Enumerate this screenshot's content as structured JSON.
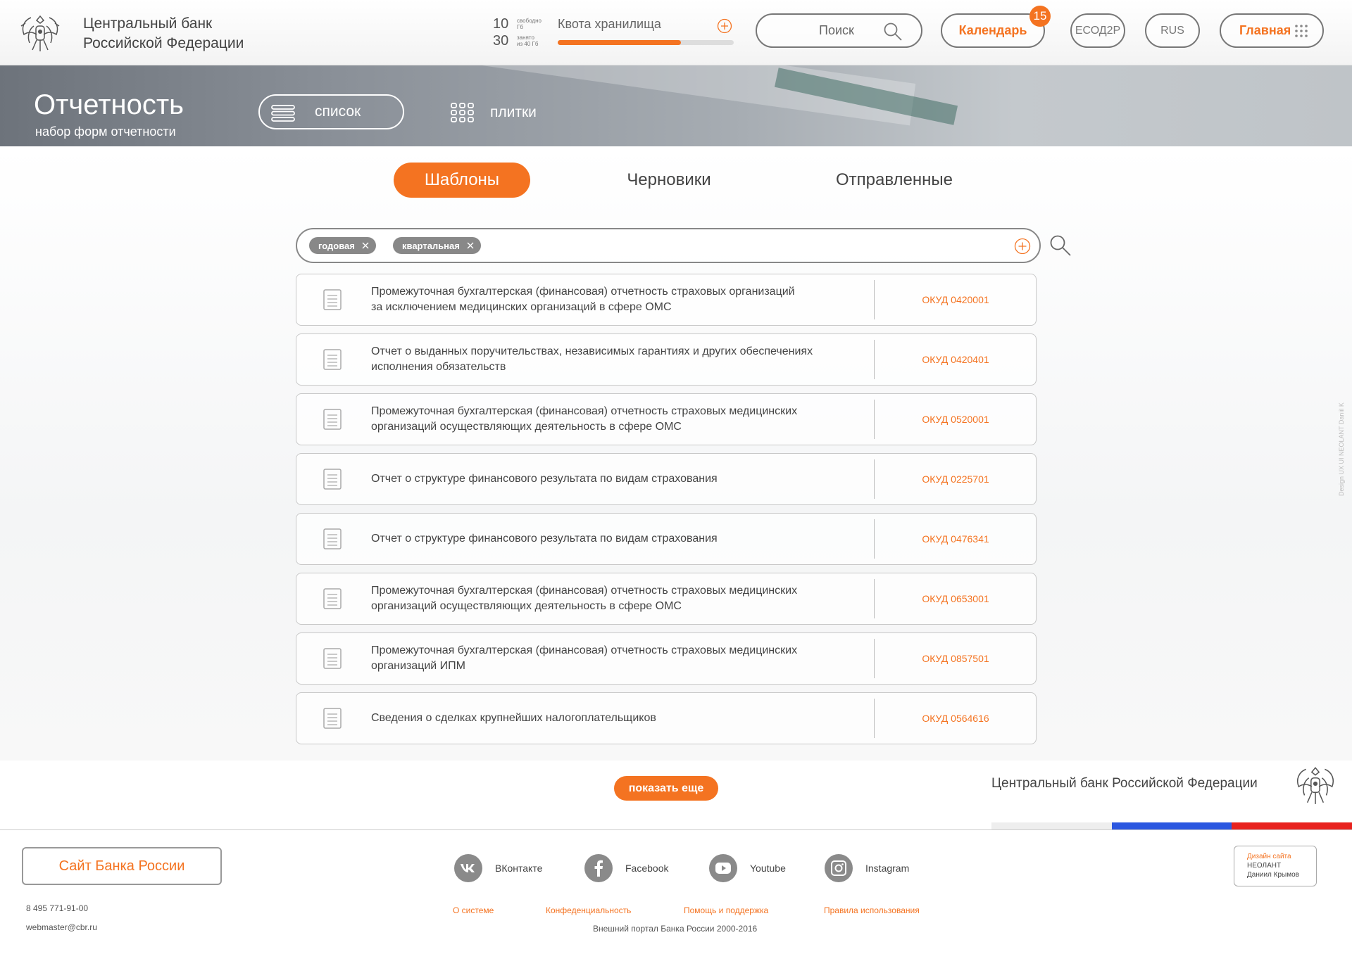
{
  "header": {
    "bank_name_line1": "Центральный банк",
    "bank_name_line2": "Российской Федерации",
    "quota": {
      "free_value": "10",
      "free_label1": "свободно",
      "free_label2": "Гб",
      "used_value": "30",
      "used_label1": "занято",
      "used_label2": "из 40 Гб",
      "title": "Квота хранилища",
      "fill_fraction": 0.7
    },
    "search_label": "Поиск",
    "calendar_label": "Календарь",
    "calendar_badge": "15",
    "esod_label": "ЕСОД2Р",
    "lang_label": "RUS",
    "home_label": "Главная"
  },
  "banner": {
    "title": "Отчетность",
    "subtitle": "набор форм отчетности",
    "view_list_label": "список",
    "view_tiles_label": "плитки"
  },
  "tabs": [
    {
      "label": "Шаблоны",
      "active": true
    },
    {
      "label": "Черновики",
      "active": false
    },
    {
      "label": "Отправленные",
      "active": false
    }
  ],
  "filter": {
    "chips": [
      "годовая",
      "квартальная"
    ]
  },
  "reports": [
    {
      "title_line1": "Промежуточная бухгалтерская (финансовая) отчетность страховых организаций",
      "title_line2": "за исключением медицинских организаций в сфере ОМС",
      "okud": "ОКУД 0420001"
    },
    {
      "title_line1": "Отчет о выданных поручительствах, независимых гарантиях и других  обеспечениях",
      "title_line2": "исполнения обязательств",
      "okud": "ОКУД 0420401"
    },
    {
      "title_line1": "Промежуточная бухгалтерская (финансовая) отчетность страховых медицинских",
      "title_line2": "организаций осуществляющих деятельность в сфере ОМС",
      "okud": "ОКУД 0520001"
    },
    {
      "title_line1": "Отчет о структуре финансового результата по видам страхования",
      "title_line2": "",
      "okud": "ОКУД 0225701"
    },
    {
      "title_line1": "Отчет о структуре финансового результата по видам страхования",
      "title_line2": "",
      "okud": "ОКУД 0476341"
    },
    {
      "title_line1": "Промежуточная бухгалтерская (финансовая) отчетность страховых медицинских",
      "title_line2": "организаций осуществляющих деятельность в сфере ОМС",
      "okud": "ОКУД 0653001"
    },
    {
      "title_line1": "Промежуточная бухгалтерская (финансовая) отчетность страховых медицинских",
      "title_line2": "организаций  ИПМ",
      "okud": "ОКУД 0857501"
    },
    {
      "title_line1": "Сведения о сделках крупнейших налогоплательщиков",
      "title_line2": "",
      "okud": "ОКУД 0564616"
    }
  ],
  "show_more_label": "показать еще",
  "footer": {
    "bank_full_name": "Центральный банк Российской Федерации",
    "site_button": "Сайт Банка России",
    "phone": "8 495 771-91-00",
    "email": "webmaster@cbr.ru",
    "social": [
      "ВКонтакте",
      "Facebook",
      "Youtube",
      "Instagram"
    ],
    "links": [
      "О системе",
      "Конфеденциальность",
      "Помощь и поддержка",
      "Правила использования"
    ],
    "copyright": "Внешний портал Банка России 2000-2016",
    "credit_line1": "Дизайн сайта",
    "credit_line2": "НЕОЛАНТ",
    "credit_line3": "Даниил Крымов",
    "side_credit": "Design UX UI NEOLANT Daniil K"
  },
  "colors": {
    "accent": "#f47321",
    "flag_white": "#eeeeee",
    "flag_blue": "#2b57e0",
    "flag_red": "#e8221e"
  }
}
